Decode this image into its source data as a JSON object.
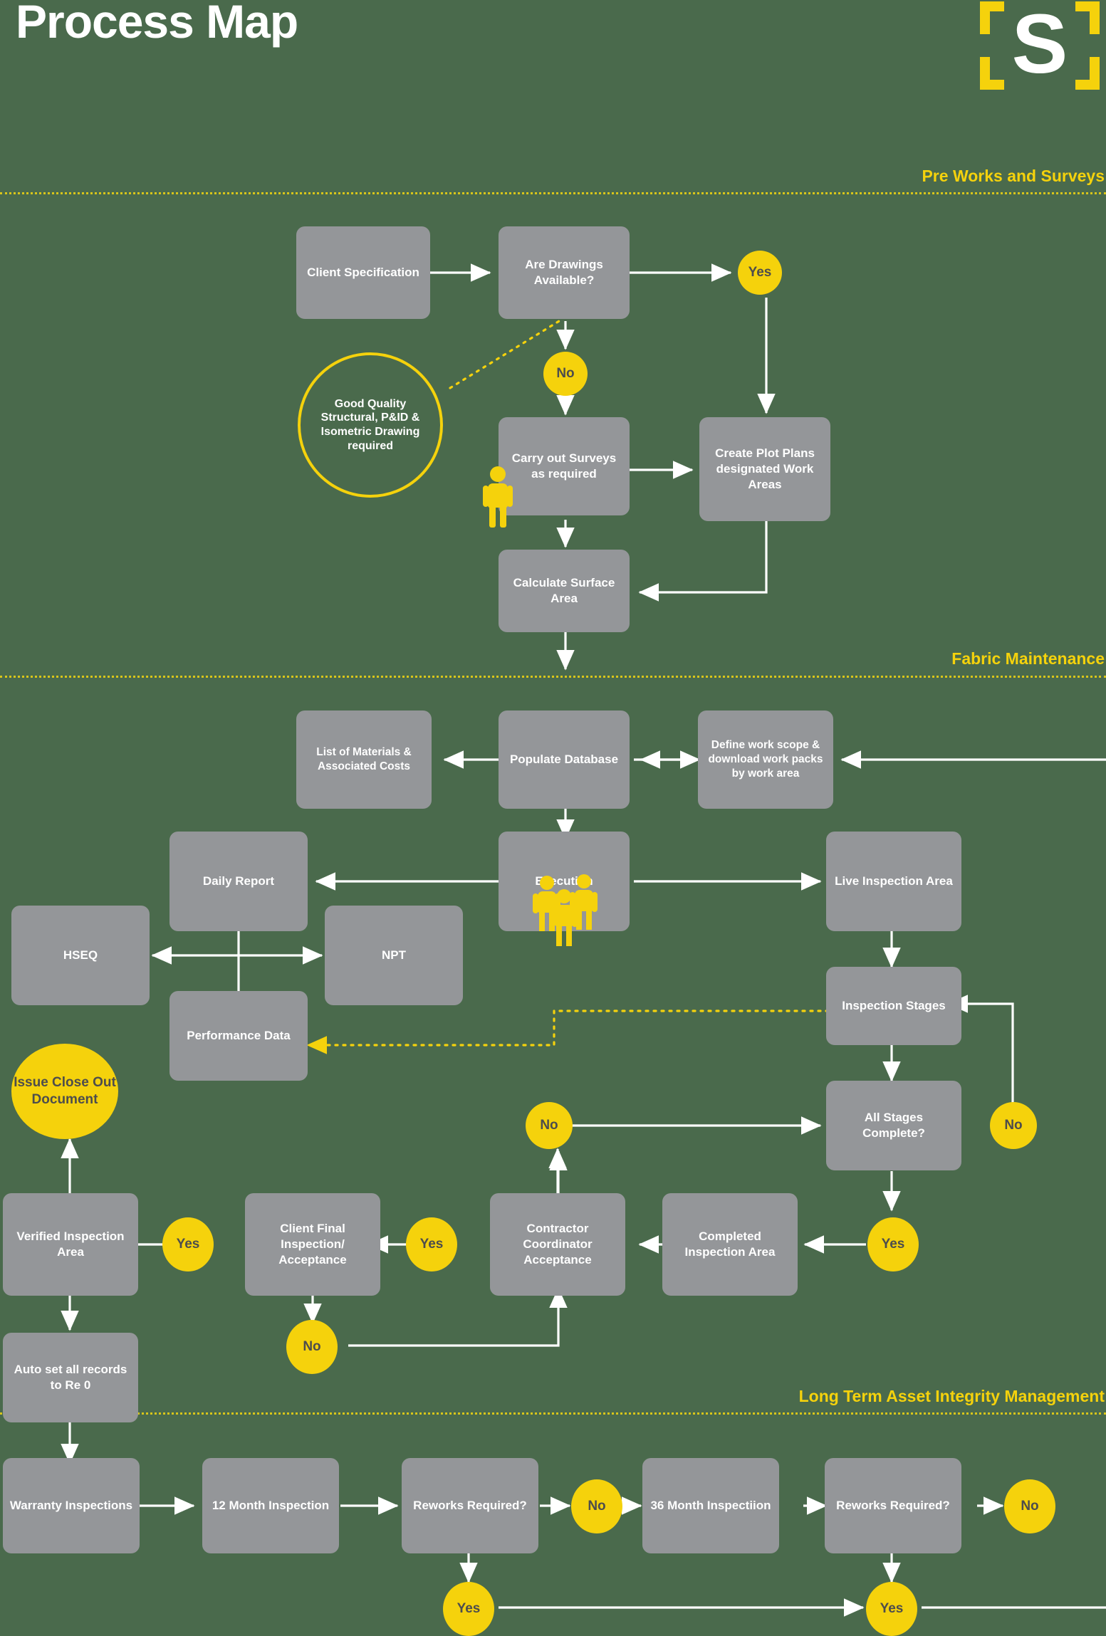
{
  "page": {
    "title": "Process Map",
    "logo_letter": "S",
    "background_color": "#4a6a4c",
    "accent_color": "#f5d20c",
    "node_color": "#949699"
  },
  "bands": [
    {
      "label": "Pre Works and Surveys"
    },
    {
      "label": "Fabric Maintenance"
    },
    {
      "label": "Long Term Asset Integrity Management"
    }
  ],
  "nodes": {
    "client_specification": "Client Specification",
    "are_drawings_available": "Are Drawings Available?",
    "yes_drawings": "Yes",
    "no_drawings": "No",
    "good_quality_note": "Good Quality Structural, P&ID & Isometric Drawing required",
    "carry_out_surveys": "Carry out Surveys as required",
    "create_plot_plans": "Create Plot Plans designated Work Areas",
    "calculate_surface_area": "Calculate Surface Area",
    "list_of_materials": "List of Materials & Associated Costs",
    "populate_database": "Populate Database",
    "define_work_scope": "Define work scope & download work packs by work area",
    "daily_report": "Daily Report",
    "execution": "Execution",
    "live_inspection_area": "Live Inspection Area",
    "hseq": "HSEQ",
    "npt": "NPT",
    "performance_data": "Performance Data",
    "inspection_stages": "Inspection Stages",
    "issue_close_out": "Issue Close Out Document",
    "no_stages_left": "No",
    "all_stages_complete": "All Stages Complete?",
    "no_stages_right": "No",
    "verified_inspection_area": "Verified Inspection Area",
    "yes_client_final": "Yes",
    "client_final_inspection": "Client Final Inspection/ Acceptance",
    "yes_contractor": "Yes",
    "contractor_coordinator": "Contractor Coordinator Acceptance",
    "completed_inspection_area": "Completed Inspection Area",
    "yes_all_stages": "Yes",
    "auto_set_records": "Auto set all records to Re 0",
    "no_client_final": "No",
    "warranty_inspections": "Warranty Inspections",
    "twelve_month_inspection": "12 Month Inspection",
    "reworks_required_1": "Reworks Required?",
    "no_reworks_1": "No",
    "thirtysix_month_inspection": "36 Month Inspectiion",
    "reworks_required_2": "Reworks Required?",
    "no_reworks_2": "No",
    "yes_reworks_1": "Yes",
    "yes_reworks_2": "Yes"
  }
}
